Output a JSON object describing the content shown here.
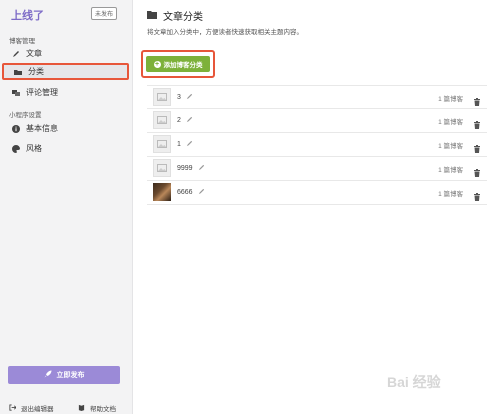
{
  "app": {
    "brand": "上线了",
    "status_badge": "未发布"
  },
  "sidebar": {
    "blog_section_title": "博客管理",
    "blog_items": [
      {
        "label": "文章",
        "icon": "pen-icon"
      },
      {
        "label": "分类",
        "icon": "folder-icon",
        "active": true
      },
      {
        "label": "评论管理",
        "icon": "comments-icon"
      }
    ],
    "mini_section_title": "小程序设置",
    "mini_items": [
      {
        "label": "基本信息",
        "icon": "info-icon"
      },
      {
        "label": "风格",
        "icon": "palette-icon"
      }
    ],
    "publish_label": "立即发布",
    "exit_label": "退出编辑器",
    "help_label": "帮助文档"
  },
  "main": {
    "title": "文章分类",
    "description": "将文章加入分类中，方便读者快速获取相关主题内容。",
    "add_button": "添加博客分类",
    "categories": [
      {
        "name": "3",
        "count": "1 篇博客",
        "thumb": "placeholder"
      },
      {
        "name": "2",
        "count": "1 篇博客",
        "thumb": "placeholder"
      },
      {
        "name": "1",
        "count": "1 篇博客",
        "thumb": "placeholder"
      },
      {
        "name": "9999",
        "count": "1 篇博客",
        "thumb": "placeholder"
      },
      {
        "name": "6666",
        "count": "1 篇博客",
        "thumb": "photo"
      }
    ]
  },
  "watermark": "Bai 经验",
  "colors": {
    "brand": "#7d6bc7",
    "publish": "#9b8ad7",
    "add": "#7db13a",
    "highlight": "#e7563a"
  }
}
